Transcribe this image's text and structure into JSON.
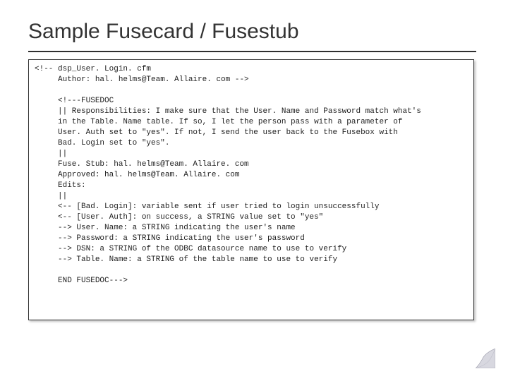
{
  "title": "Sample Fusecard / Fusestub",
  "code": "<!-- dsp_User. Login. cfm\n     Author: hal. helms@Team. Allaire. com -->\n\n     <!---FUSEDOC\n     || Responsibilities: I make sure that the User. Name and Password match what's\n     in the Table. Name table. If so, I let the person pass with a parameter of\n     User. Auth set to \"yes\". If not, I send the user back to the Fusebox with\n     Bad. Login set to \"yes\".\n     ||\n     Fuse. Stub: hal. helms@Team. Allaire. com\n     Approved: hal. helms@Team. Allaire. com\n     Edits:\n     ||\n     <-- [Bad. Login]: variable sent if user tried to login unsuccessfully\n     <-- [User. Auth]: on success, a STRING value set to \"yes\"\n     --> User. Name: a STRING indicating the user's name\n     --> Password: a STRING indicating the user's password\n     --> DSN: a STRING of the ODBC datasource name to use to verify\n     --> Table. Name: a STRING of the table name to use to verify\n\n     END FUSEDOC--->"
}
